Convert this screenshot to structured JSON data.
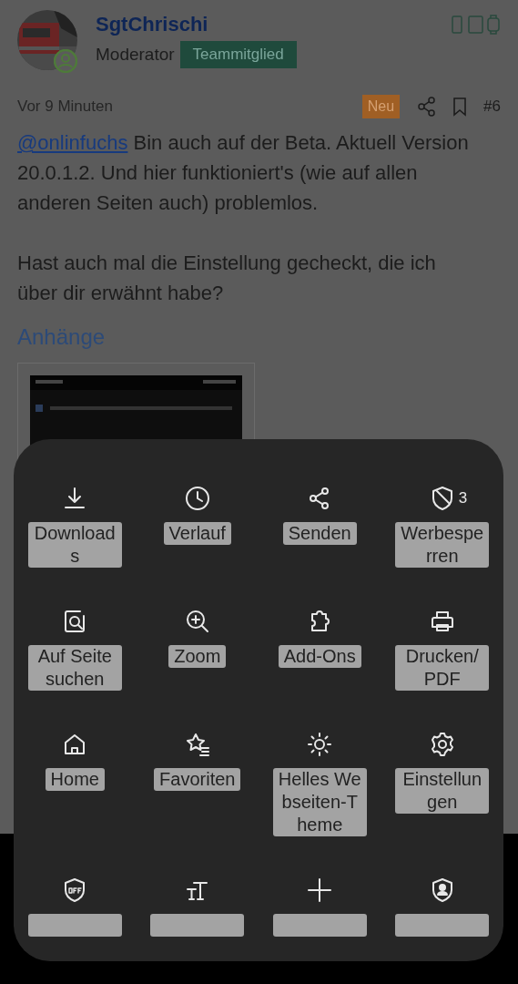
{
  "post": {
    "author": "SgtChrischi",
    "role": "Moderator",
    "badge": "Teammitglied",
    "time": "Vor 9 Minuten",
    "new_badge": "Neu",
    "number": "#6",
    "body": [
      {
        "kind": "mention",
        "mention": "@onlinfuchs",
        "text": " Bin auch auf der Beta. Aktuell Version 20.0.1.2. Und hier funktioniert's (wie auf allen anderen Seiten auch) problemlos."
      },
      {
        "kind": "plain",
        "text": "Hast auch mal die Einstellung gecheckt, die ich über dir erwähnt habe?"
      }
    ],
    "attachments_title": "Anhänge"
  },
  "menu": {
    "items": [
      {
        "kind": "labeled",
        "label": "Downloads"
      },
      {
        "kind": "labeled",
        "label": "Verlauf"
      },
      {
        "kind": "labeled",
        "label": "Senden"
      },
      {
        "kind": "labeled",
        "label": "Werbesperren",
        "count": "3"
      },
      {
        "kind": "labeled",
        "label": "Auf Seite suchen"
      },
      {
        "kind": "labeled",
        "label": "Zoom"
      },
      {
        "kind": "labeled",
        "label": "Add-Ons"
      },
      {
        "kind": "labeled",
        "label": "Drucken/PDF"
      },
      {
        "kind": "labeled",
        "label": "Home"
      },
      {
        "kind": "labeled",
        "label": "Favoriten"
      },
      {
        "kind": "labeled",
        "label": "Helles Webseiten-Theme"
      },
      {
        "kind": "labeled",
        "label": "Einstellungen"
      },
      {
        "kind": "cut"
      },
      {
        "kind": "cut"
      },
      {
        "kind": "cut"
      },
      {
        "kind": "cut"
      }
    ]
  }
}
